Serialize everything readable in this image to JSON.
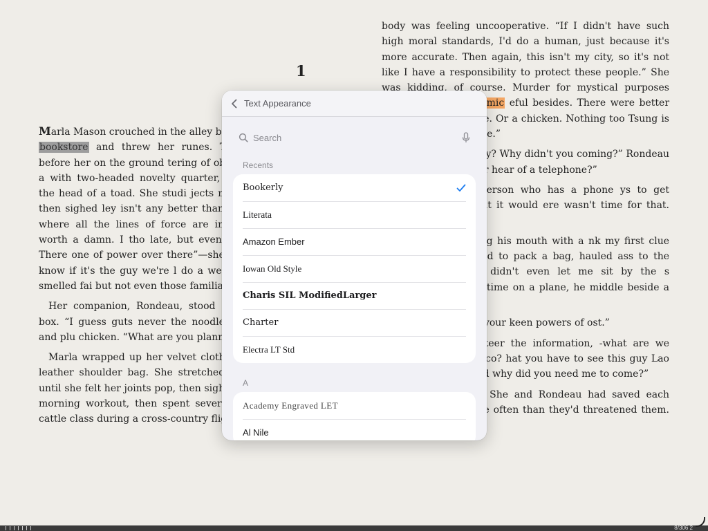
{
  "book": {
    "chapter_number": "1",
    "left_paragraphs": [
      {
        "dropcap": "M",
        "before": "arla Mason crouched in the alley be",
        "highlight": "bookstore",
        "after": " and threw her runes. The s velvet spread before her on the ground tering of objects—a garlic clove, a with two-headed novelty quarter, fingerna stone from the head of a toad. She studi jects made for a long time, then sighed ley isn't any better than the other two know where all the lines of force are in terpret the scatter worth a damn. I tho late, but even then it's too vague. There one of power over there”—she gesture “but I don't know if it's the guy we're l do a wet divination.” The air smelled fai but not even those familiar urban smell"
      },
      "Her companion, Rondeau, stood slurp a waxed-paper box. “I guess guts never the noodles with his chopstick and plu chicken. “What are you planning to evis",
      "Marla wrapped up her velvet cloth a stowed them in a leather shoulder bag. She stretched her arms overhead until she felt her joints pop, then sighed. She'd missed her morning workout, then spent several hours cramped in cattle class during a cross-country flight, and her"
    ],
    "right_paragraphs": [
      {
        "before": "body was feeling uncooperative. “If I didn't have such high moral standards, I'd do a human, just because it's more accurate. Then again, this isn't my city, so it's not like I have a responsibility to protect these people.” She was kidding, of course. Murder for mystical purposes incurred a nasty ",
        "highlight": "karmic",
        "after": " eful besides. There were better uses for A cat, maybe. Or a chicken. Nothing too Tsung is trying to hide from me.”"
      },
      "look for him anyway? Why didn't you coming?” Rondeau wiggled his fingers er hear of a telephone?”",
      "not the kind of person who has a phone ys to get messages to him, but it would ere wasn't time for that. I'm in a hurry.”",
      "ondeau said, wiping his mouth with a nk my first clue was when you busted to pack a bag, hauled ass to the airport, plane. You didn't even let me sit by the s aggrieved. “My first time on a plane, he middle beside a fat guy with sweat",
      "at, too? I think it's your keen powers of ost.”",
      "oping you'd volunteer the information, -what are we doing in San Francisco? hat you have to see this guy Lao Tsung right now? And why did you need me to come?”",
      "Marla considered. She and Rondeau had saved each other's lives far more often than they'd threatened them. Keeping se-"
    ]
  },
  "scrubber": {
    "position_label": "8/306 2"
  },
  "popover": {
    "back_label": "Text Appearance",
    "search_placeholder": "Search",
    "recents_label": "Recents",
    "recents": [
      {
        "label": "Bookerly",
        "selected": true
      },
      {
        "label": "Literata"
      },
      {
        "label": "Amazon Ember"
      },
      {
        "label": "Iowan Old Style"
      },
      {
        "label": "Charis SIL ModifiedLarger"
      },
      {
        "label": "Charter"
      },
      {
        "label": "Electra LT Std"
      }
    ],
    "section_a_label": "A",
    "section_a": [
      {
        "label": "Academy Engraved LET"
      },
      {
        "label": "Al Nile"
      }
    ],
    "accent_color": "#1a7cf0"
  }
}
